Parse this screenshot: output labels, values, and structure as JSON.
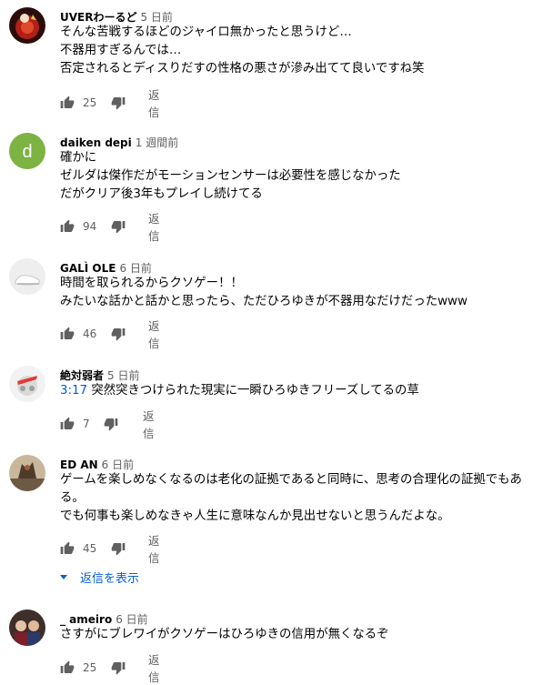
{
  "comments": [
    {
      "author": "UVERわーるど",
      "time": "5 日前",
      "lines": [
        "そんな苦戦するほどのジャイロ無かったと思うけど…",
        "不器用すぎるんでは…",
        "否定されるとディスりだすの性格の悪さが滲み出てて良いですね笑"
      ],
      "likes": "25",
      "reply": "返信"
    },
    {
      "author": "daiken depi",
      "time": "1 週間前",
      "avatar_letter": "d",
      "lines": [
        "確かに",
        "ゼルダは傑作だがモーションセンサーは必要性を感じなかった",
        "だがクリア後3年もプレイし続けてる"
      ],
      "likes": "94",
      "reply": "返信"
    },
    {
      "author": "GALÌ OLE",
      "time": "6 日前",
      "lines": [
        "時間を取られるからクソゲー！！",
        "みたいな話かと話かと思ったら、ただひろゆきが不器用なだけだったwww"
      ],
      "likes": "46",
      "reply": "返信"
    },
    {
      "author": "絶対弱者",
      "time": "5 日前",
      "timestamp_link": "3:17",
      "lines": [
        " 突然突きつけられた現実に一瞬ひろゆきフリーズしてるの草"
      ],
      "likes": "7",
      "reply": "返信"
    },
    {
      "author": "ED AN",
      "time": "6 日前",
      "lines": [
        "ゲームを楽しめなくなるのは老化の証拠であると同時に、思考の合理化の証拠でもあ",
        "る。",
        "でも何事も楽しめなきゃ人生に意味なんか見出せないと思うんだよな。"
      ],
      "likes": "45",
      "reply": "返信",
      "show_replies": "返信を表示"
    },
    {
      "author": "_ ameiro",
      "time": "6 日前",
      "lines": [
        "さすがにブレワイがクソゲーはひろゆきの信用が無くなるぞ"
      ],
      "likes": "25",
      "reply": "返信"
    }
  ],
  "colors": {
    "author": "#030303",
    "meta": "#606060",
    "link": "#065fd4",
    "daiken_avatar": "#7cb342"
  },
  "icons": [
    "like-icon",
    "dislike-icon",
    "chevron-down-icon"
  ]
}
